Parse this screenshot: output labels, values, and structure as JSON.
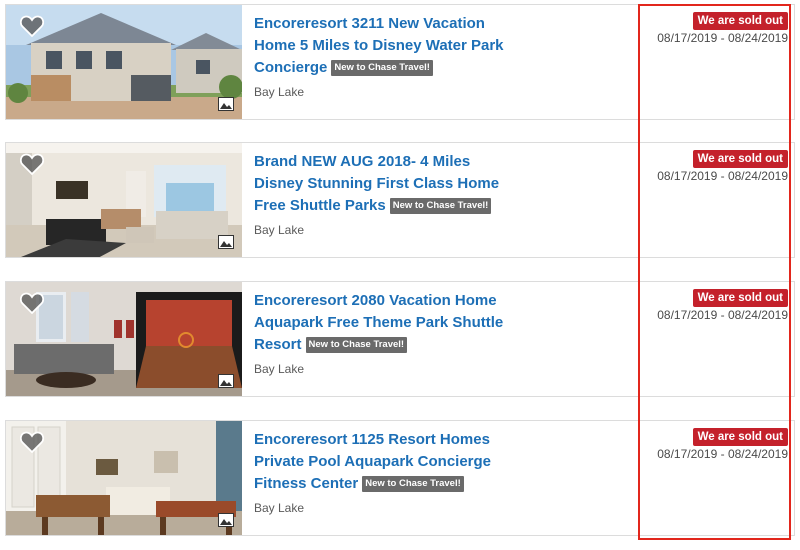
{
  "colors": {
    "title_link": "#1d6fb6",
    "sold_out_badge": "#c4212b",
    "new_badge": "#6a6a6a",
    "highlight_box": "#e2261c"
  },
  "listings": [
    {
      "title": "Encoreresort 3211 New Vacation Home 5 Miles to Disney Water Park Concierge",
      "badge": "New to Chase Travel!",
      "location": "Bay Lake",
      "status": "We are sold out",
      "dates": "08/17/2019 - 08/24/2019",
      "icons": [
        "heart-icon",
        "gallery-icon"
      ]
    },
    {
      "title": "Brand NEW AUG 2018- 4 Miles Disney Stunning First Class Home Free Shuttle Parks",
      "badge": "New to Chase Travel!",
      "location": "Bay Lake",
      "status": "We are sold out",
      "dates": "08/17/2019 - 08/24/2019",
      "icons": [
        "heart-icon",
        "gallery-icon"
      ]
    },
    {
      "title": "Encoreresort 2080 Vacation Home Aquapark Free Theme Park Shuttle Resort",
      "badge": "New to Chase Travel!",
      "location": "Bay Lake",
      "status": "We are sold out",
      "dates": "08/17/2019 - 08/24/2019",
      "icons": [
        "heart-icon",
        "gallery-icon"
      ]
    },
    {
      "title": "Encoreresort 1125 Resort Homes Private Pool Aquapark Concierge Fitness Center",
      "badge": "New to Chase Travel!",
      "location": "Bay Lake",
      "status": "We are sold out",
      "dates": "08/17/2019 - 08/24/2019",
      "icons": [
        "heart-icon",
        "gallery-icon"
      ]
    }
  ]
}
